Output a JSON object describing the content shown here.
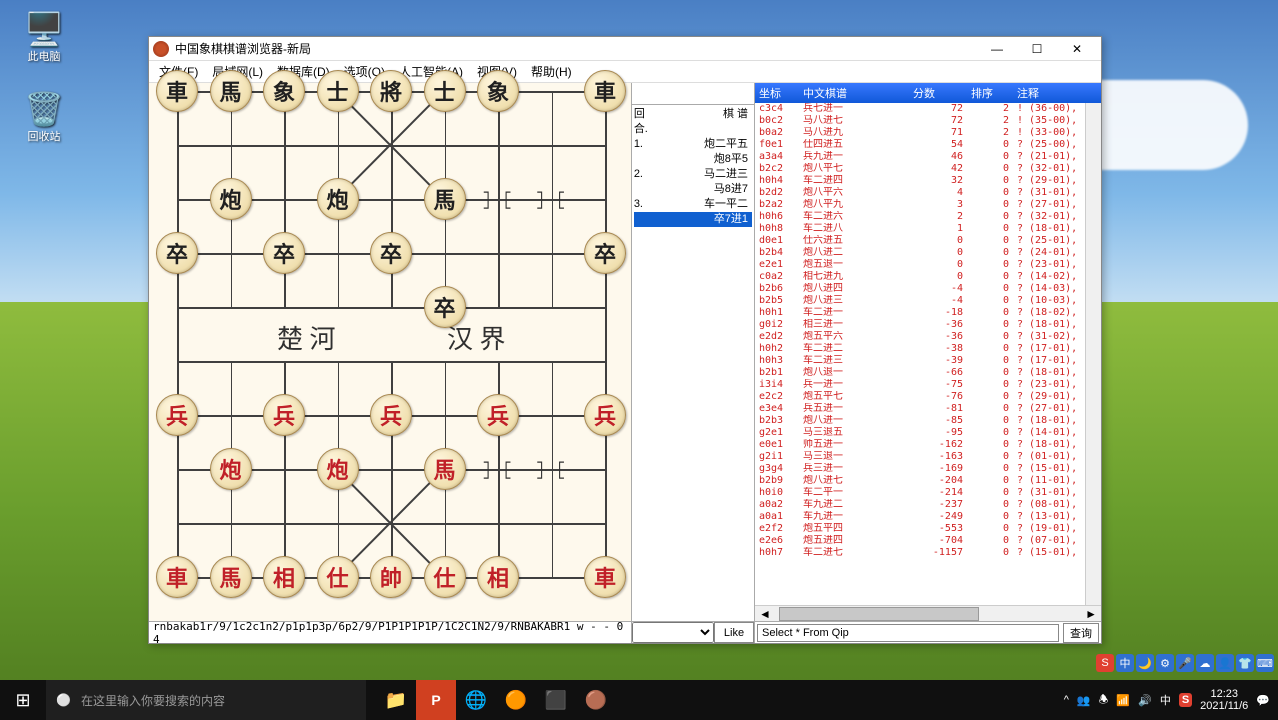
{
  "desktop": {
    "icons": [
      {
        "name": "此电脑",
        "glyph": "🖥️"
      },
      {
        "name": "回收站",
        "glyph": "🗑️"
      }
    ]
  },
  "window": {
    "title": "中国象棋棋谱浏览器-新局",
    "buttons": {
      "min": "—",
      "max": "☐",
      "close": "✕"
    }
  },
  "menu": [
    "文件(F)",
    "局域网(L)",
    "数据库(D)",
    "选项(O)",
    "人工智能(A)",
    "视图(V)",
    "帮助(H)"
  ],
  "board": {
    "river_left": "楚 河",
    "river_right": "汉 界",
    "pieces_black_top": [
      "車",
      "馬",
      "象",
      "士",
      "將",
      "士",
      "象",
      "",
      "車"
    ],
    "row2": [
      null,
      "炮",
      null,
      "炮",
      null,
      "馬",
      null,
      null,
      null
    ],
    "row3": [
      "卒",
      null,
      "卒",
      null,
      "卒",
      null,
      null,
      null,
      "卒"
    ],
    "row4": [
      null,
      null,
      null,
      null,
      null,
      "卒",
      null,
      null,
      null
    ],
    "row6": [
      "兵",
      null,
      "兵",
      null,
      "兵",
      null,
      "兵",
      null,
      "兵"
    ],
    "row7": [
      null,
      "炮",
      null,
      "炮",
      null,
      "馬",
      null,
      null,
      null
    ],
    "pieces_red_bot": [
      "車",
      "馬",
      "相",
      "仕",
      "帥",
      "仕",
      "相",
      "",
      "車"
    ]
  },
  "fen": "rnbakab1r/9/1c2c1n2/p1p1p3p/6p2/9/P1P1P1P1P/1C2C1N2/9/RNBAKABR1 w - - 0 4",
  "moves": {
    "header": {
      "round": "回合.",
      "pu": "棋    谱"
    },
    "rows": [
      {
        "no": "1.",
        "a": "炮二平五",
        "b": "炮8平5"
      },
      {
        "no": "2.",
        "a": "马二进三",
        "b": "马8进7"
      },
      {
        "no": "3.",
        "a": "车一平二",
        "b": "卒7进1"
      }
    ],
    "selected": 5
  },
  "like": "Like",
  "table": {
    "headers": [
      "坐标",
      "中文棋谱",
      "分数",
      "排序",
      "注释"
    ],
    "widths": [
      44,
      110,
      58,
      46,
      80
    ],
    "rows": [
      [
        "c3c4",
        "兵七进一",
        "72",
        "2",
        "! (36-00),"
      ],
      [
        "b0c2",
        "马八进七",
        "72",
        "2",
        "! (35-00),"
      ],
      [
        "b0a2",
        "马八进九",
        "71",
        "2",
        "! (33-00),"
      ],
      [
        "f0e1",
        "仕四进五",
        "54",
        "0",
        "? (25-00),"
      ],
      [
        "a3a4",
        "兵九进一",
        "46",
        "0",
        "? (21-01),"
      ],
      [
        "b2c2",
        "炮八平七",
        "42",
        "0",
        "? (32-01),"
      ],
      [
        "h0h4",
        "车二进四",
        "32",
        "0",
        "? (29-01),"
      ],
      [
        "b2d2",
        "炮八平六",
        "4",
        "0",
        "? (31-01),"
      ],
      [
        "b2a2",
        "炮八平九",
        "3",
        "0",
        "? (27-01),"
      ],
      [
        "h0h6",
        "车二进六",
        "2",
        "0",
        "? (32-01),"
      ],
      [
        "h0h8",
        "车二进八",
        "1",
        "0",
        "? (18-01),"
      ],
      [
        "d0e1",
        "仕六进五",
        "0",
        "0",
        "? (25-01),"
      ],
      [
        "b2b4",
        "炮八进二",
        "0",
        "0",
        "? (24-01),"
      ],
      [
        "e2e1",
        "炮五退一",
        "0",
        "0",
        "? (23-01),"
      ],
      [
        "c0a2",
        "相七进九",
        "0",
        "0",
        "? (14-02),"
      ],
      [
        "b2b6",
        "炮八进四",
        "-4",
        "0",
        "? (14-03),"
      ],
      [
        "b2b5",
        "炮八进三",
        "-4",
        "0",
        "? (10-03),"
      ],
      [
        "h0h1",
        "车二进一",
        "-18",
        "0",
        "? (18-02),"
      ],
      [
        "g0i2",
        "相三进一",
        "-36",
        "0",
        "? (18-01),"
      ],
      [
        "e2d2",
        "炮五平六",
        "-36",
        "0",
        "? (31-02),"
      ],
      [
        "h0h2",
        "车二进二",
        "-38",
        "0",
        "? (17-01),"
      ],
      [
        "h0h3",
        "车二进三",
        "-39",
        "0",
        "? (17-01),"
      ],
      [
        "b2b1",
        "炮八退一",
        "-66",
        "0",
        "? (18-01),"
      ],
      [
        "i3i4",
        "兵一进一",
        "-75",
        "0",
        "? (23-01),"
      ],
      [
        "e2c2",
        "炮五平七",
        "-76",
        "0",
        "? (29-01),"
      ],
      [
        "e3e4",
        "兵五进一",
        "-81",
        "0",
        "? (27-01),"
      ],
      [
        "b2b3",
        "炮八进一",
        "-85",
        "0",
        "? (18-01),"
      ],
      [
        "g2e1",
        "马三退五",
        "-95",
        "0",
        "? (14-01),"
      ],
      [
        "e0e1",
        "帅五进一",
        "-162",
        "0",
        "? (18-01),"
      ],
      [
        "g2i1",
        "马三退一",
        "-163",
        "0",
        "? (01-01),"
      ],
      [
        "g3g4",
        "兵三进一",
        "-169",
        "0",
        "? (15-01),"
      ],
      [
        "b2b9",
        "炮八进七",
        "-204",
        "0",
        "? (11-01),"
      ],
      [
        "h0i0",
        "车二平一",
        "-214",
        "0",
        "? (31-01),"
      ],
      [
        "a0a2",
        "车九进二",
        "-237",
        "0",
        "? (08-01),"
      ],
      [
        "a0a1",
        "车九进一",
        "-249",
        "0",
        "? (13-01),"
      ],
      [
        "e2f2",
        "炮五平四",
        "-553",
        "0",
        "? (19-01),"
      ],
      [
        "e2e6",
        "炮五进四",
        "-704",
        "0",
        "? (07-01),"
      ],
      [
        "h0h7",
        "车二进七",
        "-1157",
        "0",
        "? (15-01),"
      ]
    ]
  },
  "query": {
    "sql": "Select * From Qip",
    "btn": "查询"
  },
  "taskbar": {
    "search_placeholder": "在这里输入你要搜索的内容",
    "time": "12:23",
    "date": "2021/11/6"
  },
  "ime": [
    "S",
    "中",
    "🌙",
    "⚙",
    "🎤",
    "☁",
    "👤",
    "👕",
    "⌨"
  ]
}
